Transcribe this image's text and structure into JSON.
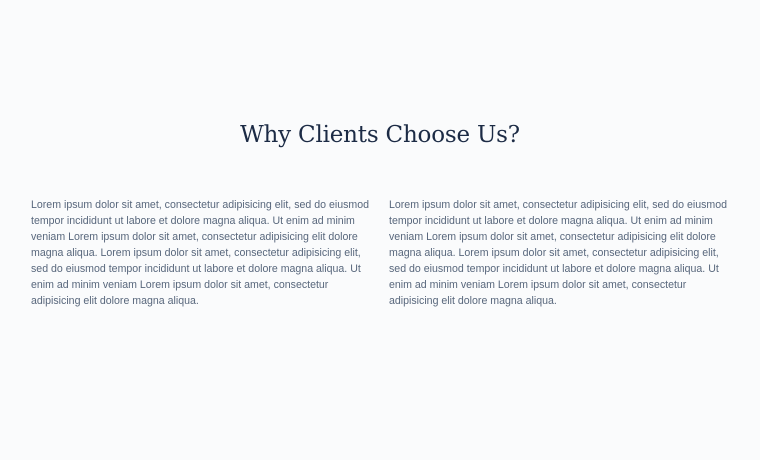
{
  "section": {
    "heading": "Why Clients Choose Us?",
    "columns": [
      {
        "text": "Lorem ipsum dolor sit amet, consectetur adipisicing elit, sed do eiusmod tempor incididunt ut labore et dolore magna aliqua. Ut enim ad minim veniam Lorem ipsum dolor sit amet, consectetur adipisicing elit dolore magna aliqua. Lorem ipsum dolor sit amet, consectetur adipisicing elit, sed do eiusmod tempor incididunt ut labore et dolore magna aliqua. Ut enim ad minim veniam Lorem ipsum dolor sit amet, consectetur adipisicing elit dolore magna aliqua."
      },
      {
        "text": "Lorem ipsum dolor sit amet, consectetur adipisicing elit, sed do eiusmod tempor incididunt ut labore et dolore magna aliqua. Ut enim ad minim veniam Lorem ipsum dolor sit amet, consectetur adipisicing elit dolore magna aliqua. Lorem ipsum dolor sit amet, consectetur adipisicing elit, sed do eiusmod tempor incididunt ut labore et dolore magna aliqua. Ut enim ad minim veniam Lorem ipsum dolor sit amet, consectetur adipisicing elit dolore magna aliqua."
      }
    ]
  }
}
